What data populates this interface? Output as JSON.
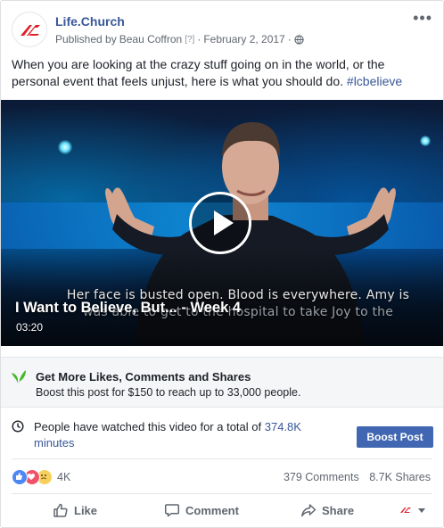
{
  "header": {
    "page_name": "Life.Church",
    "published_prefix": "Published by",
    "author": "Beau Coffron",
    "help_mark": "[?]",
    "date": "February 2, 2017",
    "separator": "·",
    "more_glyph": "•••"
  },
  "post": {
    "text": "When you are looking at the crazy stuff going on in the world, or the personal event that feels unjust, here is what you should do.",
    "hashtag": "#lcbelieve"
  },
  "video": {
    "title": "I Want to Believe, But... - Week 4",
    "duration": "03:20",
    "caption_line1": "Her face is busted open. Blood is everywhere. Amy is",
    "caption_line2": "was able to get to the hospital to take Joy to the"
  },
  "promo": {
    "title": "Get More Likes, Comments and Shares",
    "description": "Boost this post for $150 to reach up to 33,000 people."
  },
  "insights": {
    "text_before": "People have watched this video for a total of",
    "highlight": "374.8K",
    "text_after": "minutes",
    "boost_button": "Boost Post"
  },
  "engagement": {
    "reaction_count": "4K",
    "comments": "379 Comments",
    "shares": "8.7K Shares"
  },
  "actions": {
    "like": "Like",
    "comment": "Comment",
    "share": "Share"
  },
  "colors": {
    "link": "#385898",
    "button": "#4267b2",
    "brand": "#e0202b"
  },
  "icons": {
    "globe": "globe-icon",
    "leaf": "leaf-icon",
    "clock": "clock-icon",
    "like": "thumbs-up-icon",
    "comment": "comment-bubble-icon",
    "share": "share-arrow-icon",
    "play": "play-icon"
  }
}
